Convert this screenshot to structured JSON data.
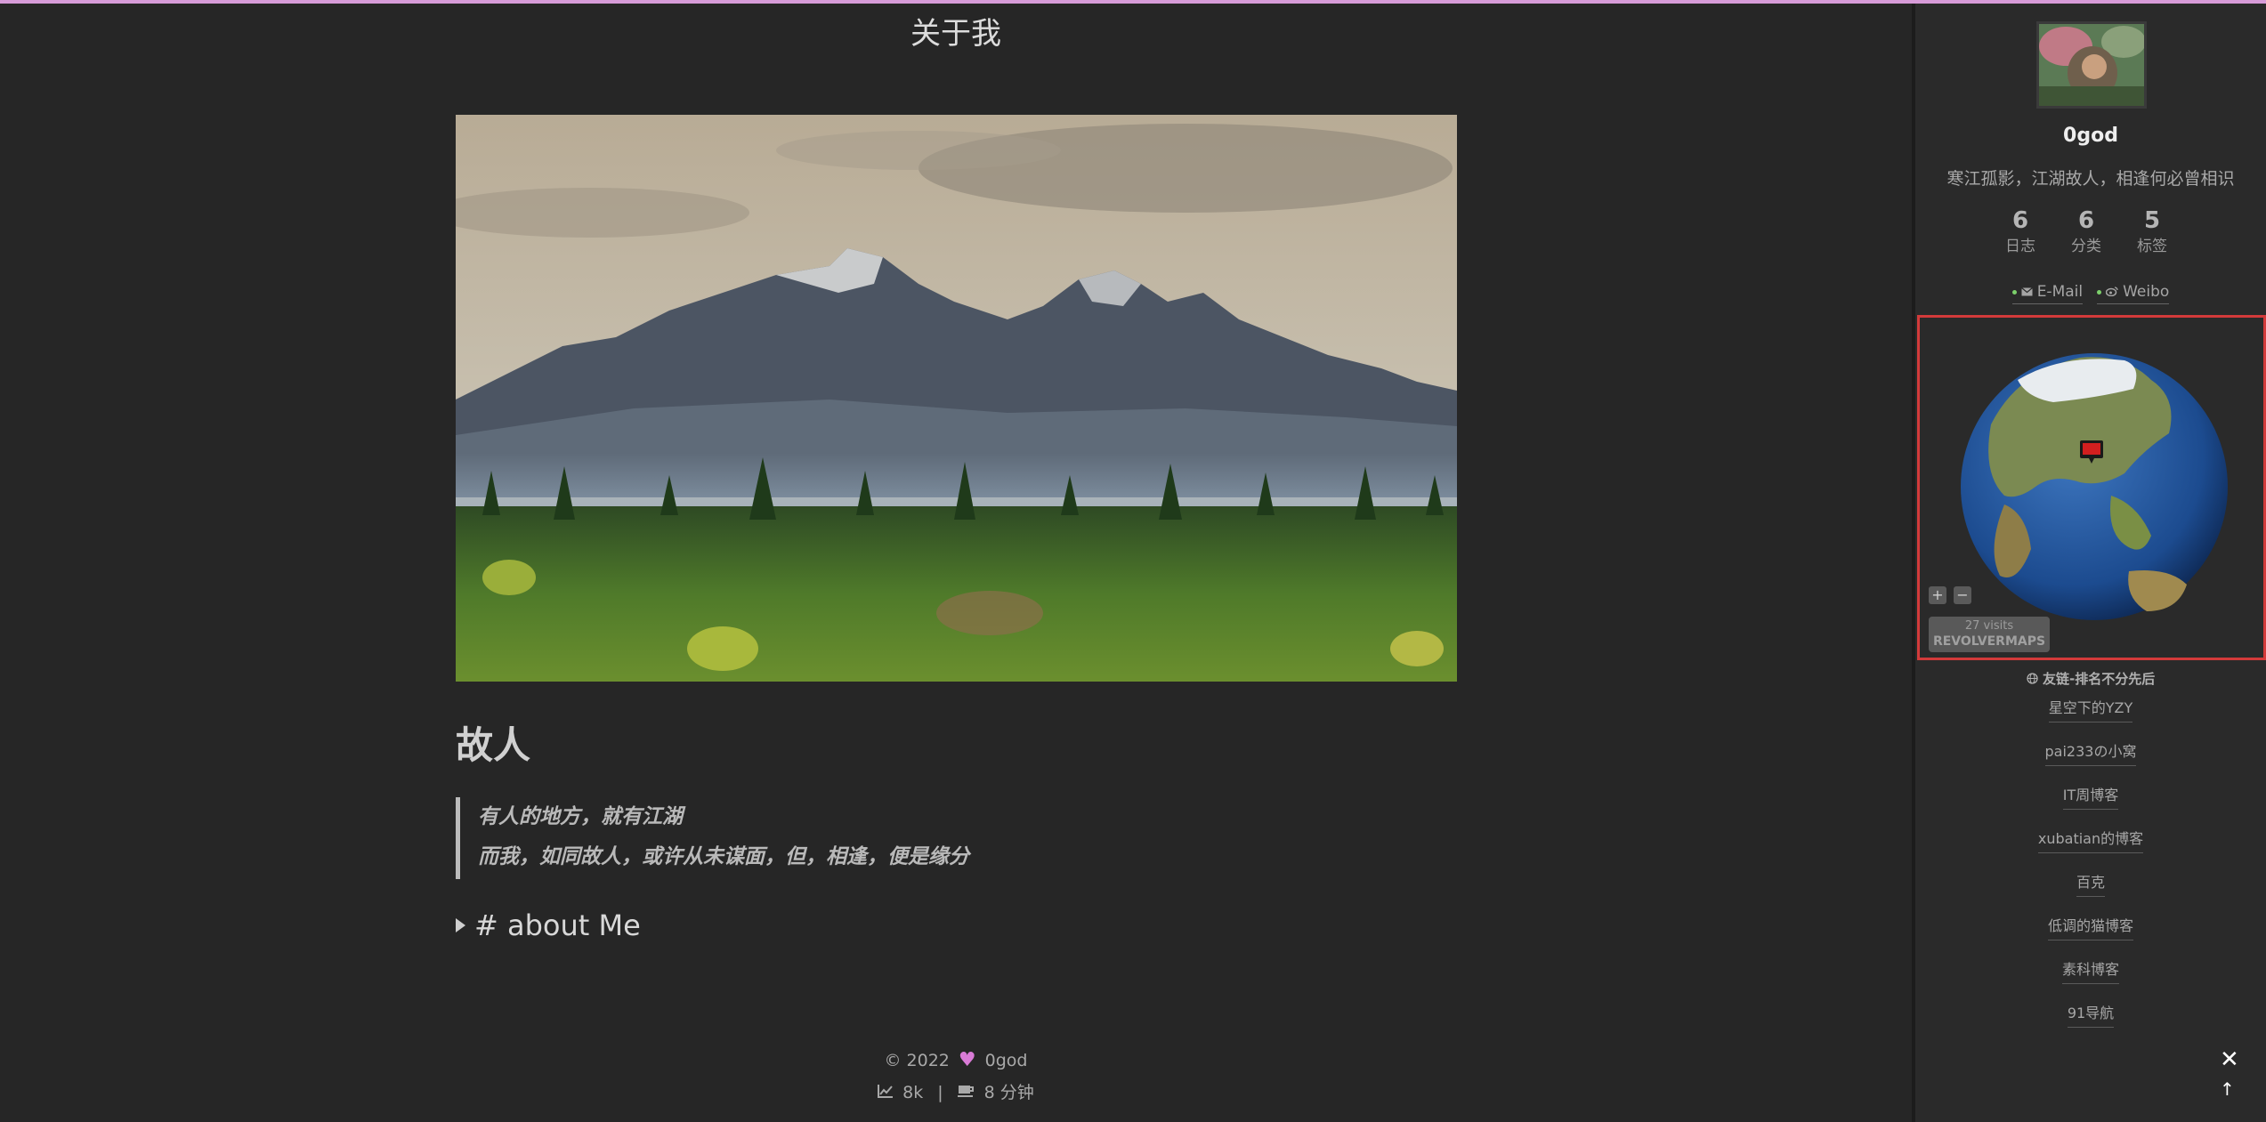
{
  "page": {
    "title": "关于我",
    "accent_color": "#d79bd8"
  },
  "post": {
    "heading": "故人",
    "quote_lines": [
      "有人的地方，就有江湖",
      "而我，如同故人，或许从未谋面，但，相逢，便是缘分"
    ],
    "details_summary": "# about Me"
  },
  "footer": {
    "copyright": "© 2022",
    "author": "0god",
    "views": "8k",
    "reading_time": "8 分钟"
  },
  "sidebar": {
    "author_name": "0god",
    "author_desc": "寒江孤影，江湖故人，相逢何必曾相识",
    "stats": [
      {
        "count": "6",
        "label": "日志"
      },
      {
        "count": "6",
        "label": "分类"
      },
      {
        "count": "5",
        "label": "标签"
      }
    ],
    "links": [
      {
        "label": "E-Mail",
        "icon": "envelope-icon"
      },
      {
        "label": "Weibo",
        "icon": "weibo-icon"
      }
    ],
    "globe": {
      "zoom_in": "+",
      "zoom_out": "−",
      "visits": "27 visits",
      "brand": "REVOLVERMAPS"
    },
    "blogroll_title": "友链-排名不分先后",
    "blogroll": [
      "星空下的YZY",
      "pai233の小窝",
      "IT周博客",
      "xubatian的博客",
      "百克",
      "低调的猫博客",
      "素科博客",
      "91导航"
    ]
  },
  "widgets": {
    "close": "✕",
    "back_to_top": "↑"
  }
}
